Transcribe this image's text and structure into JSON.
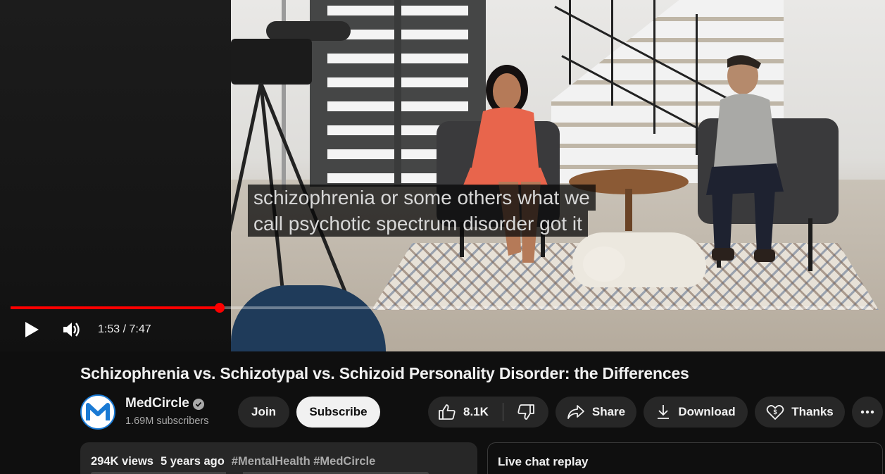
{
  "player": {
    "captions": [
      "schizophrenia or some others what we",
      "call psychotic spectrum disorder got it"
    ],
    "time": "1:53 / 7:47",
    "progress": 0.242
  },
  "video": {
    "title": "Schizophrenia vs. Schizotypal vs. Schizoid Personality Disorder: the Differences"
  },
  "channel": {
    "name": "MedCircle",
    "subscribers": "1.69M subscribers",
    "avatar_letter": "M"
  },
  "actions": {
    "join": "Join",
    "subscribe": "Subscribe",
    "likes": "8.1K",
    "share": "Share",
    "download": "Download",
    "thanks": "Thanks"
  },
  "description": {
    "views": "294K views",
    "age": "5 years ago",
    "tags": [
      "#MentalHealth",
      "#MedCircle"
    ]
  },
  "chat": {
    "title": "Live chat replay"
  },
  "colors": {
    "progress": "#ff0000",
    "background": "#0f0f0f",
    "pill": "#272727",
    "avatar_accent": "#1a7ad4"
  }
}
